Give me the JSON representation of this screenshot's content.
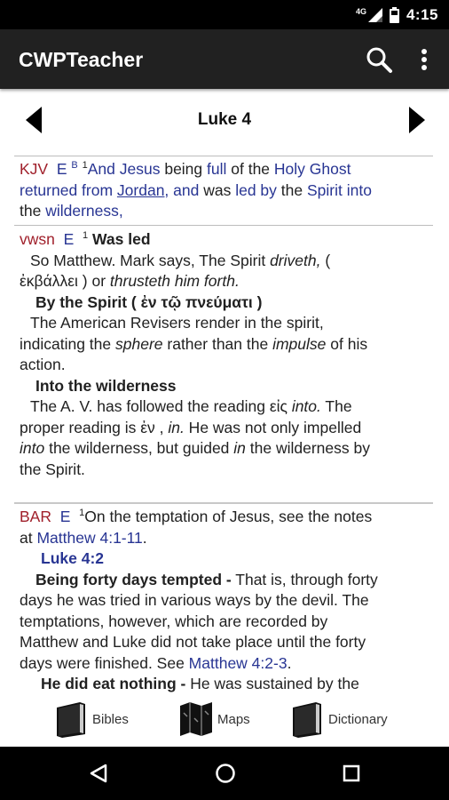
{
  "status_bar": {
    "network": "4G",
    "time": "4:15"
  },
  "app_bar": {
    "title": "CWPTeacher"
  },
  "chapter_nav": {
    "title": "Luke 4"
  },
  "kjv": {
    "source": "KJV",
    "marker_e": "E",
    "marker_b": "B",
    "verse_num": "1",
    "w1": "And Jesus",
    "w2": " being ",
    "w3": "full",
    "w4": " of the ",
    "w5": "Holy Ghost",
    "w6": "returned from",
    "w7": "Jordan,",
    "w8": " and",
    "w9": " was ",
    "w10": "led by",
    "w11": " the ",
    "w12": "Spirit into",
    "w13": "the ",
    "w14": "wilderness,"
  },
  "vwsn": {
    "source": "vwsn",
    "marker_e": "E",
    "verse_num": "1",
    "heading1": "Was led",
    "l1a": "So Matthew. Mark says, The Spirit ",
    "l1b": "driveth,",
    "l1c": " (",
    "l2a": "ἐκβάλλει ) or ",
    "l2b": "thrusteth him forth.",
    "heading2": "By the Spirit ( ἐν τῷ πνεύματι )",
    "l3": "The American Revisers render in the spirit,",
    "l4a": "indicating the ",
    "l4b": "sphere",
    "l4c": " rather than the ",
    "l4d": "impulse",
    "l4e": " of his",
    "l5": "action.",
    "heading3": "Into the wilderness",
    "l6a": "The A. V. has followed the reading εἰς ",
    "l6b": "into.",
    "l6c": " The",
    "l7a": "proper reading is ἐν , ",
    "l7b": "in.",
    "l7c": " He was not only impelled",
    "l8a": "into",
    "l8b": " the wilderness, but guided ",
    "l8c": "in",
    "l8d": " the wilderness by",
    "l9": "the Spirit."
  },
  "bar": {
    "source": "BAR",
    "marker_e": "E",
    "verse_num": "1",
    "l1": "On the temptation of Jesus, see the notes",
    "l2a": "at ",
    "l2b": "Matthew 4:1-11",
    "l2c": ".",
    "ref": "Luke 4:2",
    "h1": "Being forty days tempted -",
    "l3": " That is, through forty",
    "l4": "days he was tried in various ways by the devil. The",
    "l5": "temptations, however, which are recorded by",
    "l6": "Matthew and Luke did not take place until the forty",
    "l7a": "days were finished. See ",
    "l7b": "Matthew 4:2-3",
    "l7c": ".",
    "h2": "He did eat nothing -",
    "l8": " He was sustained by the"
  },
  "bottom_bar": {
    "bibles": "Bibles",
    "maps": "Maps",
    "dictionary": "Dictionary"
  },
  "colors": {
    "app_bar": "#212121",
    "link_blue": "#283593",
    "source_red": "#a0202b"
  }
}
